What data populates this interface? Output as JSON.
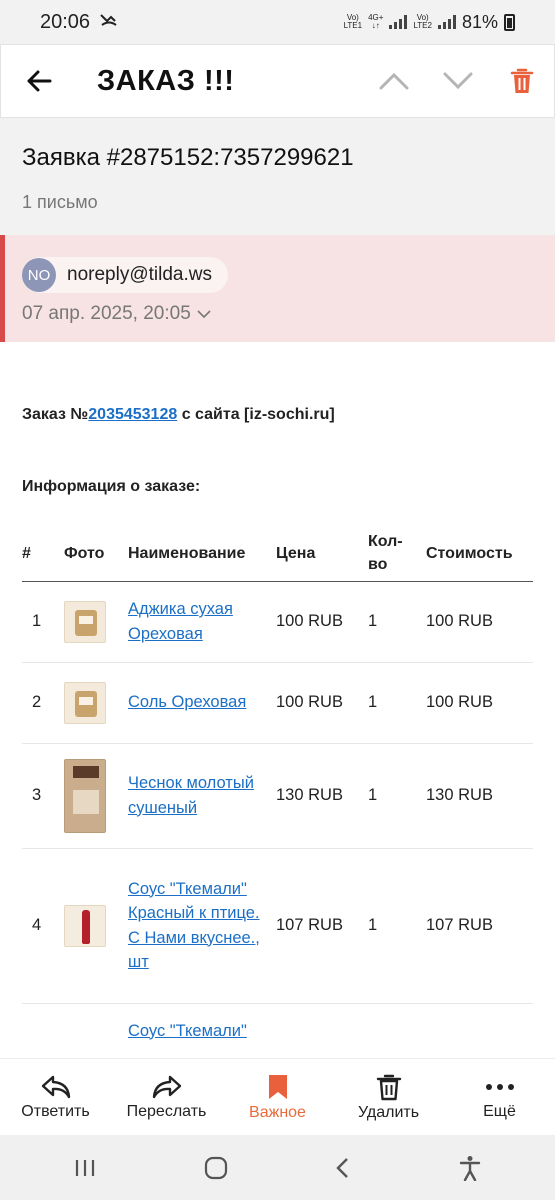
{
  "status": {
    "time": "20:06",
    "sim1": {
      "top": "Vo)",
      "bottom": "LTE1"
    },
    "sim2": {
      "top": "Vo)",
      "bottom": "LTE2"
    },
    "network": "4G+",
    "battery": "81%"
  },
  "header": {
    "title": "ЗАКАЗ !!!",
    "icons": [
      "back-arrow-icon",
      "chevron-up-icon",
      "chevron-down-icon",
      "trash-icon"
    ],
    "accent": "#e8613c"
  },
  "subject": {
    "title": "Заявка #2875152:7357299621",
    "count": "1 письмо"
  },
  "sender": {
    "initials": "NO",
    "email": "noreply@tilda.ws",
    "date": "07 апр. 2025, 20:05"
  },
  "body": {
    "order_prefix": "Заказ №",
    "order_number": "2035453128",
    "order_suffix": " с сайта [iz-sochi.ru]",
    "info_title": "Информация о заказе:",
    "columns": [
      "#",
      "Фото",
      "Наименование",
      "Цена",
      "Кол-\nво",
      "Стоимость"
    ],
    "rows": [
      {
        "n": "1",
        "name": "Аджика сухая Ореховая",
        "price": "100 RUB",
        "qty": "1",
        "total": "100 RUB"
      },
      {
        "n": "2",
        "name": "Соль Ореховая",
        "price": "100 RUB",
        "qty": "1",
        "total": "100 RUB"
      },
      {
        "n": "3",
        "name": "Чеснок молотый сушеный",
        "price": "130 RUB",
        "qty": "1",
        "total": "130 RUB"
      },
      {
        "n": "4",
        "name": "Соус \"Ткемали\" Красный к птице. С Нами вкуснее., шт",
        "price": "107 RUB",
        "qty": "1",
        "total": "107 RUB"
      },
      {
        "n": "",
        "name": "Соус \"Ткемали\"",
        "price": "",
        "qty": "",
        "total": ""
      }
    ]
  },
  "actions": [
    {
      "label": "Ответить",
      "icon": "reply-icon"
    },
    {
      "label": "Переслать",
      "icon": "forward-icon"
    },
    {
      "label": "Важное",
      "icon": "bookmark-icon"
    },
    {
      "label": "Удалить",
      "icon": "trash-icon"
    },
    {
      "label": "Ещё",
      "icon": "more-icon"
    }
  ]
}
